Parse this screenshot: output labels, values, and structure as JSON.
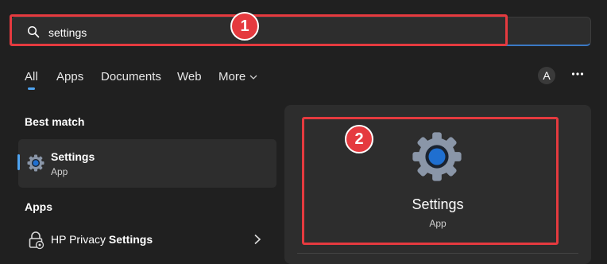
{
  "search": {
    "query": "settings"
  },
  "tabs": [
    {
      "label": "All"
    },
    {
      "label": "Apps"
    },
    {
      "label": "Documents"
    },
    {
      "label": "Web"
    },
    {
      "label": "More"
    }
  ],
  "header_right": {
    "avatar_initial": "A",
    "more_icon": "ellipsis-icon"
  },
  "best_match": {
    "heading": "Best match",
    "item": {
      "title": "Settings",
      "subtitle": "App",
      "icon": "settings-gear-icon"
    }
  },
  "apps_section": {
    "heading": "Apps",
    "items": [
      {
        "label_prefix": "HP Privacy ",
        "label_bold": "Settings",
        "icon": "lock-gear-icon"
      }
    ]
  },
  "preview": {
    "title": "Settings",
    "subtitle": "App",
    "icon": "settings-gear-icon"
  },
  "annotations": [
    {
      "number": "1"
    },
    {
      "number": "2"
    }
  ],
  "colors": {
    "accent": "#4ea3f0",
    "annotation": "#e53a3f",
    "background": "#202020",
    "panel": "#2d2d2d"
  }
}
